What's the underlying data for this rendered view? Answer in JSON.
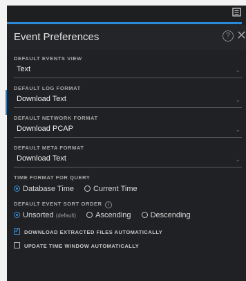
{
  "panel": {
    "title": "Event Preferences",
    "help_glyph": "?",
    "close_glyph": "✕"
  },
  "sections": {
    "events_view": {
      "label": "DEFAULT EVENTS VIEW",
      "value": "Text"
    },
    "log_format": {
      "label": "DEFAULT LOG FORMAT",
      "value": "Download Text"
    },
    "network_format": {
      "label": "DEFAULT NETWORK FORMAT",
      "value": "Download PCAP"
    },
    "meta_format": {
      "label": "DEFAULT META FORMAT",
      "value": "Download Text"
    },
    "time_format": {
      "label": "TIME FORMAT FOR QUERY",
      "options": [
        "Database Time",
        "Current Time"
      ],
      "selected": "Database Time"
    },
    "sort_order": {
      "label": "DEFAULT EVENT SORT ORDER",
      "info_glyph": "i",
      "options": [
        "Unsorted",
        "Ascending",
        "Descending"
      ],
      "default_tag": "(default)",
      "selected": "Unsorted"
    }
  },
  "checkboxes": {
    "download_extracted": {
      "label": "DOWNLOAD EXTRACTED FILES AUTOMATICALLY",
      "checked": true
    },
    "update_time_window": {
      "label": "UPDATE TIME WINDOW AUTOMATICALLY",
      "checked": false
    }
  },
  "icons": {
    "chevron": "⌄",
    "toolbar_button": "preferences-icon"
  },
  "colors": {
    "accent": "#2a8ad8",
    "panel_bg": "#202124"
  }
}
